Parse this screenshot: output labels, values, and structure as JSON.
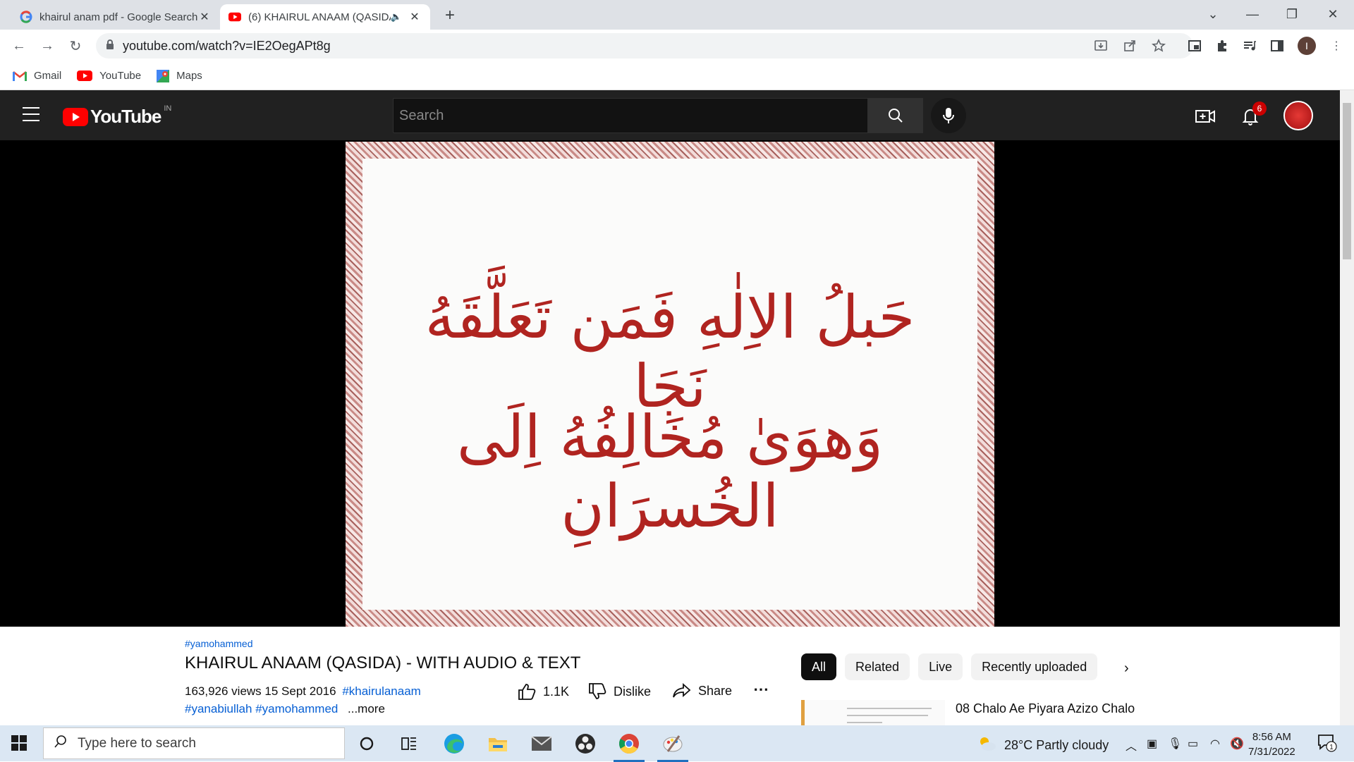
{
  "browser": {
    "tabs": [
      {
        "title": "khairul anam pdf - Google Search",
        "favicon": "google-icon",
        "active": false
      },
      {
        "title": "(6) KHAIRUL ANAAM (QASIDA) - WITH AUDIO & TEXT",
        "favicon": "youtube-icon",
        "active": true,
        "audio": true
      }
    ],
    "url": "youtube.com/watch?v=IE2OegAPt8g",
    "bookmarks": [
      {
        "label": "Gmail",
        "icon": "gmail-icon"
      },
      {
        "label": "YouTube",
        "icon": "youtube-icon"
      },
      {
        "label": "Maps",
        "icon": "maps-icon"
      }
    ],
    "profile_initial": "I"
  },
  "youtube": {
    "logo_text": "YouTube",
    "country_code": "IN",
    "search_placeholder": "Search",
    "notification_count": "6"
  },
  "video": {
    "verse_line_1": "حَبلُ الاِلٰهِ فَمَن تَعَلَّقَهُ نَجَا",
    "verse_line_2": "وَهوَیٰ مُخَالِفُهُ اِلَی الخُسرَانِ",
    "hashtag_top": "#yamohammed",
    "title": "KHAIRUL ANAAM (QASIDA) - WITH AUDIO & TEXT",
    "views": "163,926 views",
    "date": "15 Sept 2016",
    "tag1": "#khairulanaam",
    "tags_line2": "#yanabiullah #yamohammed",
    "more_label": "...more",
    "likes": "1.1K",
    "dislike_label": "Dislike",
    "share_label": "Share"
  },
  "sidebar": {
    "chips": [
      "All",
      "Related",
      "Live",
      "Recently uploaded"
    ],
    "active_chip": "All",
    "first_rec_title": "08 Chalo Ae Piyara Azizo Chalo"
  },
  "taskbar": {
    "search_placeholder": "Type here to search",
    "weather": "28°C  Partly cloudy",
    "time": "8:56 AM",
    "date": "7/31/2022",
    "notification_badge": "1"
  },
  "colors": {
    "youtube_red": "#ff0000",
    "header_bg": "#212121",
    "verse_red": "#b02420",
    "link_blue": "#065fd4"
  }
}
